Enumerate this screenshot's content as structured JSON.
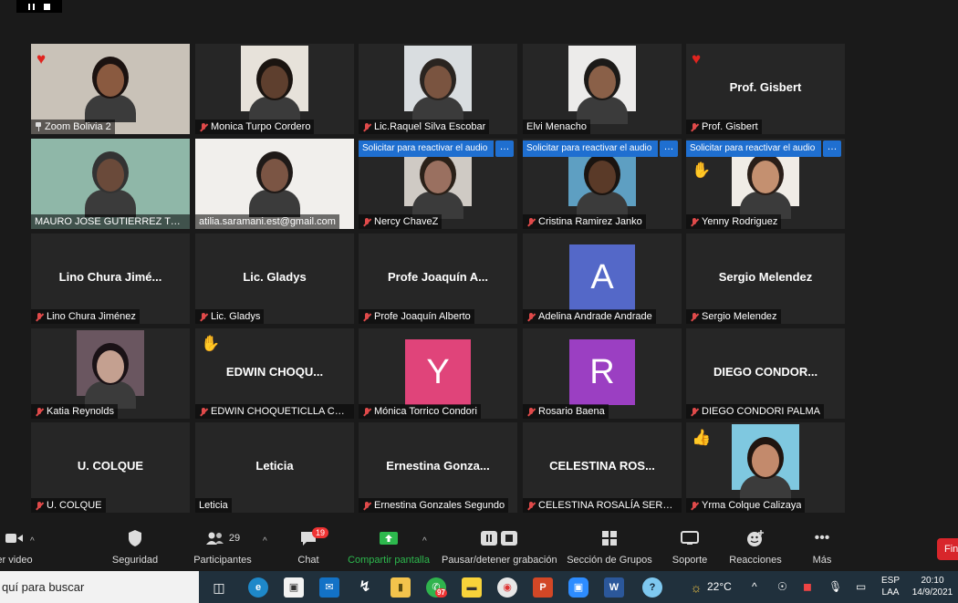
{
  "window": {
    "top_controls": [
      "pause",
      "stop"
    ]
  },
  "tiles": [
    {
      "name": "Zoom Bolivia 2",
      "center_name": "",
      "muted": false,
      "pinned": true,
      "reaction": "heart",
      "active": true,
      "video": true
    },
    {
      "name": "Monica Turpo Cordero",
      "center_name": "",
      "muted": true,
      "video": true
    },
    {
      "name": "Lic.Raquel Silva Escobar",
      "center_name": "",
      "muted": true,
      "video": true
    },
    {
      "name": "Elvi Menacho",
      "center_name": "",
      "muted": false,
      "video": true
    },
    {
      "name": "Prof. Gisbert",
      "center_name": "Prof. Gisbert",
      "muted": true,
      "reaction": "heart",
      "video": false
    },
    {
      "name": "MAURO JOSE GUTIERREZ TO...",
      "center_name": "",
      "muted": false,
      "video": true
    },
    {
      "name": "atilia.saramani.est@gmail.com",
      "center_name": "",
      "muted": false,
      "video": true
    },
    {
      "name": "Nercy ChaveZ",
      "center_name": "",
      "muted": true,
      "video": true,
      "audio_request": "Solicitar para reactivar el audio"
    },
    {
      "name": "Cristina Ramirez Janko",
      "center_name": "",
      "muted": true,
      "video": true,
      "audio_request": "Solicitar para reactivar el audio"
    },
    {
      "name": "Yenny Rodriguez",
      "center_name": "",
      "muted": true,
      "video": true,
      "audio_request": "Solicitar para reactivar el audio",
      "reaction": "clap"
    },
    {
      "name": "Lino Chura Jiménez",
      "center_name": "Lino Chura Jimé...",
      "muted": true,
      "video": false
    },
    {
      "name": "Lic. Gladys",
      "center_name": "Lic. Gladys",
      "muted": true,
      "video": false
    },
    {
      "name": "Profe Joaquín Alberto",
      "center_name": "Profe Joaquín A...",
      "muted": true,
      "video": false
    },
    {
      "name": "Adelina Andrade Andrade",
      "center_name": "",
      "muted": true,
      "video": false,
      "avatar_letter": "A",
      "avatar_color": "#5468c8"
    },
    {
      "name": "Sergio Melendez",
      "center_name": "Sergio Melendez",
      "muted": true,
      "video": false
    },
    {
      "name": "Katia Reynolds",
      "center_name": "",
      "muted": true,
      "video": true
    },
    {
      "name": "EDWIN CHOQUETICLLA CO...",
      "center_name": "EDWIN  CHOQU...",
      "muted": true,
      "video": false,
      "reaction": "clap"
    },
    {
      "name": "Mónica Torrico Condori",
      "center_name": "",
      "muted": true,
      "video": false,
      "avatar_letter": "Y",
      "avatar_color": "#e0447a"
    },
    {
      "name": "Rosario Baena",
      "center_name": "",
      "muted": true,
      "video": false,
      "avatar_letter": "R",
      "avatar_color": "#9b3fc2"
    },
    {
      "name": "DIEGO CONDORI PALMA",
      "center_name": "DIEGO  CONDOR...",
      "muted": true,
      "video": false
    },
    {
      "name": "U. COLQUE",
      "center_name": "U. COLQUE",
      "muted": true,
      "video": false
    },
    {
      "name": "Leticia",
      "center_name": "Leticia",
      "muted": false,
      "video": false
    },
    {
      "name": "Ernestina Gonzales Segundo",
      "center_name": "Ernestina  Gonza...",
      "muted": true,
      "video": false
    },
    {
      "name": "CELESTINA ROSALÍA SERN...",
      "center_name": "CELESTINA  ROS...",
      "muted": true,
      "video": false
    },
    {
      "name": "Yrma Colque Calizaya",
      "center_name": "",
      "muted": true,
      "video": true,
      "reaction": "thumbs"
    }
  ],
  "toolbar": {
    "video_label": "er video",
    "security_label": "Seguridad",
    "participants_label": "Participantes",
    "participants_count": "29",
    "chat_label": "Chat",
    "chat_badge": "19",
    "share_label": "Compartir pantalla",
    "record_label": "Pausar/detener grabación",
    "groups_label": "Sección de Grupos",
    "support_label": "Soporte",
    "reactions_label": "Reacciones",
    "more_label": "Más",
    "end_label": "Fin",
    "share_color": "#2db84d"
  },
  "taskbar": {
    "search_placeholder": "quí para buscar",
    "weather": "22°C",
    "lang_top": "ESP",
    "lang_bottom": "LAA",
    "time": "20:10",
    "date": "14/9/2021",
    "whatsapp_badge": "97"
  }
}
